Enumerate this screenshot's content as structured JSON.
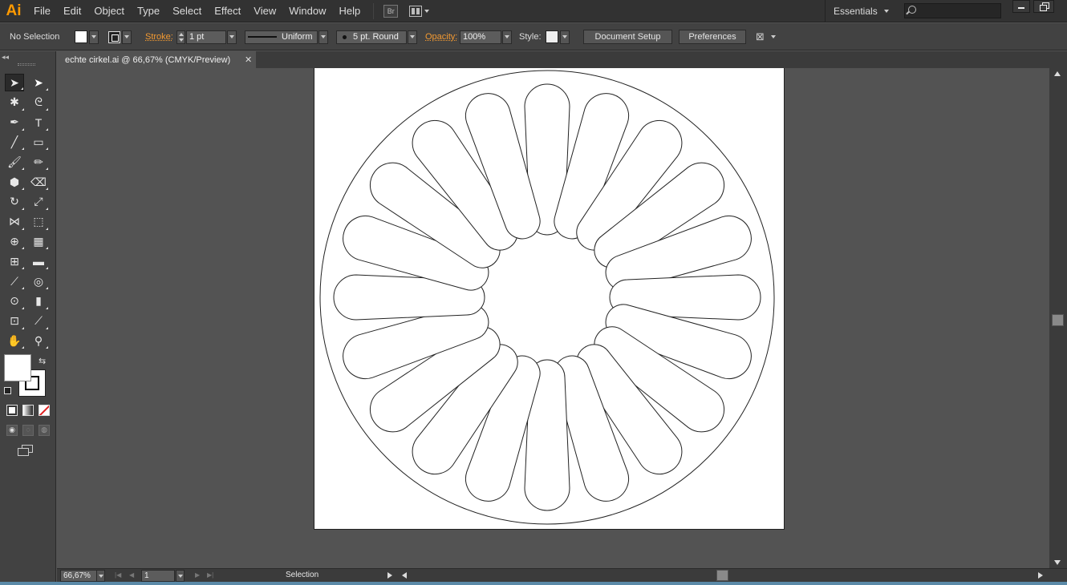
{
  "app": {
    "logo": "Ai",
    "menus": [
      "File",
      "Edit",
      "Object",
      "Type",
      "Select",
      "Effect",
      "View",
      "Window",
      "Help"
    ],
    "bridge_label": "Br",
    "workspace": "Essentials",
    "search_placeholder": ""
  },
  "control": {
    "selection_status": "No Selection",
    "stroke_label": "Stroke:",
    "stroke_weight": "1 pt",
    "stroke_profile": "Uniform",
    "brush": "5 pt. Round",
    "opacity_label": "Opacity:",
    "opacity_value": "100%",
    "style_label": "Style:",
    "document_setup": "Document Setup",
    "preferences": "Preferences"
  },
  "document": {
    "tab_title": "echte cirkel.ai @ 66,67% (CMYK/Preview)",
    "close_glyph": "✕",
    "artwork": {
      "outer_circle": true,
      "petal_count": 20
    }
  },
  "tools": [
    {
      "name": "selection-tool",
      "glyph": "➤"
    },
    {
      "name": "direct-selection-tool",
      "glyph": "➤"
    },
    {
      "name": "magic-wand-tool",
      "glyph": "✱"
    },
    {
      "name": "lasso-tool",
      "glyph": "ᘓ"
    },
    {
      "name": "pen-tool",
      "glyph": "✒"
    },
    {
      "name": "type-tool",
      "glyph": "T"
    },
    {
      "name": "line-segment-tool",
      "glyph": "╱"
    },
    {
      "name": "rectangle-tool",
      "glyph": "▭"
    },
    {
      "name": "paintbrush-tool",
      "glyph": "🖌"
    },
    {
      "name": "pencil-tool",
      "glyph": "✏"
    },
    {
      "name": "blob-brush-tool",
      "glyph": "⬢"
    },
    {
      "name": "eraser-tool",
      "glyph": "⌫"
    },
    {
      "name": "rotate-tool",
      "glyph": "↻"
    },
    {
      "name": "scale-tool",
      "glyph": "⤢"
    },
    {
      "name": "width-tool",
      "glyph": "⋈"
    },
    {
      "name": "free-transform-tool",
      "glyph": "⬚"
    },
    {
      "name": "shape-builder-tool",
      "glyph": "⊕"
    },
    {
      "name": "perspective-grid-tool",
      "glyph": "▦"
    },
    {
      "name": "mesh-tool",
      "glyph": "⊞"
    },
    {
      "name": "gradient-tool",
      "glyph": "▬"
    },
    {
      "name": "eyedropper-tool",
      "glyph": "⟋"
    },
    {
      "name": "blend-tool",
      "glyph": "◎"
    },
    {
      "name": "symbol-sprayer-tool",
      "glyph": "⊙"
    },
    {
      "name": "column-graph-tool",
      "glyph": "▮"
    },
    {
      "name": "artboard-tool",
      "glyph": "⊡"
    },
    {
      "name": "slice-tool",
      "glyph": "⟋"
    },
    {
      "name": "hand-tool",
      "glyph": "✋"
    },
    {
      "name": "zoom-tool",
      "glyph": "⚲"
    }
  ],
  "status": {
    "zoom": "66,67%",
    "artboard_number": "1",
    "current_tool": "Selection"
  },
  "colors": {
    "accent": "#ff9a00",
    "panel": "#424242",
    "canvas": "#535353",
    "stroke_label": "#f39a32"
  }
}
